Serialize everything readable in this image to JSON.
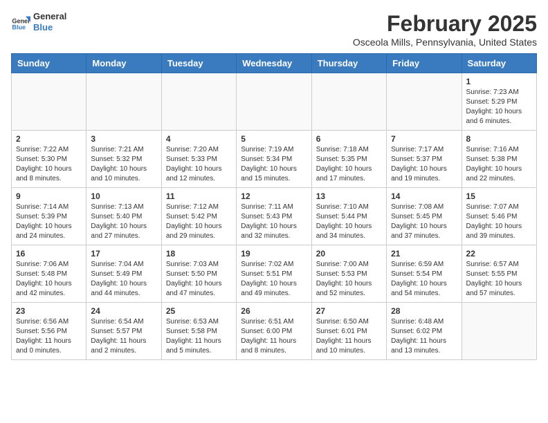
{
  "header": {
    "logo_general": "General",
    "logo_blue": "Blue",
    "month_title": "February 2025",
    "subtitle": "Osceola Mills, Pennsylvania, United States"
  },
  "weekdays": [
    "Sunday",
    "Monday",
    "Tuesday",
    "Wednesday",
    "Thursday",
    "Friday",
    "Saturday"
  ],
  "weeks": [
    [
      {
        "day": "",
        "info": ""
      },
      {
        "day": "",
        "info": ""
      },
      {
        "day": "",
        "info": ""
      },
      {
        "day": "",
        "info": ""
      },
      {
        "day": "",
        "info": ""
      },
      {
        "day": "",
        "info": ""
      },
      {
        "day": "1",
        "info": "Sunrise: 7:23 AM\nSunset: 5:29 PM\nDaylight: 10 hours\nand 6 minutes."
      }
    ],
    [
      {
        "day": "2",
        "info": "Sunrise: 7:22 AM\nSunset: 5:30 PM\nDaylight: 10 hours\nand 8 minutes."
      },
      {
        "day": "3",
        "info": "Sunrise: 7:21 AM\nSunset: 5:32 PM\nDaylight: 10 hours\nand 10 minutes."
      },
      {
        "day": "4",
        "info": "Sunrise: 7:20 AM\nSunset: 5:33 PM\nDaylight: 10 hours\nand 12 minutes."
      },
      {
        "day": "5",
        "info": "Sunrise: 7:19 AM\nSunset: 5:34 PM\nDaylight: 10 hours\nand 15 minutes."
      },
      {
        "day": "6",
        "info": "Sunrise: 7:18 AM\nSunset: 5:35 PM\nDaylight: 10 hours\nand 17 minutes."
      },
      {
        "day": "7",
        "info": "Sunrise: 7:17 AM\nSunset: 5:37 PM\nDaylight: 10 hours\nand 19 minutes."
      },
      {
        "day": "8",
        "info": "Sunrise: 7:16 AM\nSunset: 5:38 PM\nDaylight: 10 hours\nand 22 minutes."
      }
    ],
    [
      {
        "day": "9",
        "info": "Sunrise: 7:14 AM\nSunset: 5:39 PM\nDaylight: 10 hours\nand 24 minutes."
      },
      {
        "day": "10",
        "info": "Sunrise: 7:13 AM\nSunset: 5:40 PM\nDaylight: 10 hours\nand 27 minutes."
      },
      {
        "day": "11",
        "info": "Sunrise: 7:12 AM\nSunset: 5:42 PM\nDaylight: 10 hours\nand 29 minutes."
      },
      {
        "day": "12",
        "info": "Sunrise: 7:11 AM\nSunset: 5:43 PM\nDaylight: 10 hours\nand 32 minutes."
      },
      {
        "day": "13",
        "info": "Sunrise: 7:10 AM\nSunset: 5:44 PM\nDaylight: 10 hours\nand 34 minutes."
      },
      {
        "day": "14",
        "info": "Sunrise: 7:08 AM\nSunset: 5:45 PM\nDaylight: 10 hours\nand 37 minutes."
      },
      {
        "day": "15",
        "info": "Sunrise: 7:07 AM\nSunset: 5:46 PM\nDaylight: 10 hours\nand 39 minutes."
      }
    ],
    [
      {
        "day": "16",
        "info": "Sunrise: 7:06 AM\nSunset: 5:48 PM\nDaylight: 10 hours\nand 42 minutes."
      },
      {
        "day": "17",
        "info": "Sunrise: 7:04 AM\nSunset: 5:49 PM\nDaylight: 10 hours\nand 44 minutes."
      },
      {
        "day": "18",
        "info": "Sunrise: 7:03 AM\nSunset: 5:50 PM\nDaylight: 10 hours\nand 47 minutes."
      },
      {
        "day": "19",
        "info": "Sunrise: 7:02 AM\nSunset: 5:51 PM\nDaylight: 10 hours\nand 49 minutes."
      },
      {
        "day": "20",
        "info": "Sunrise: 7:00 AM\nSunset: 5:53 PM\nDaylight: 10 hours\nand 52 minutes."
      },
      {
        "day": "21",
        "info": "Sunrise: 6:59 AM\nSunset: 5:54 PM\nDaylight: 10 hours\nand 54 minutes."
      },
      {
        "day": "22",
        "info": "Sunrise: 6:57 AM\nSunset: 5:55 PM\nDaylight: 10 hours\nand 57 minutes."
      }
    ],
    [
      {
        "day": "23",
        "info": "Sunrise: 6:56 AM\nSunset: 5:56 PM\nDaylight: 11 hours\nand 0 minutes."
      },
      {
        "day": "24",
        "info": "Sunrise: 6:54 AM\nSunset: 5:57 PM\nDaylight: 11 hours\nand 2 minutes."
      },
      {
        "day": "25",
        "info": "Sunrise: 6:53 AM\nSunset: 5:58 PM\nDaylight: 11 hours\nand 5 minutes."
      },
      {
        "day": "26",
        "info": "Sunrise: 6:51 AM\nSunset: 6:00 PM\nDaylight: 11 hours\nand 8 minutes."
      },
      {
        "day": "27",
        "info": "Sunrise: 6:50 AM\nSunset: 6:01 PM\nDaylight: 11 hours\nand 10 minutes."
      },
      {
        "day": "28",
        "info": "Sunrise: 6:48 AM\nSunset: 6:02 PM\nDaylight: 11 hours\nand 13 minutes."
      },
      {
        "day": "",
        "info": ""
      }
    ]
  ]
}
